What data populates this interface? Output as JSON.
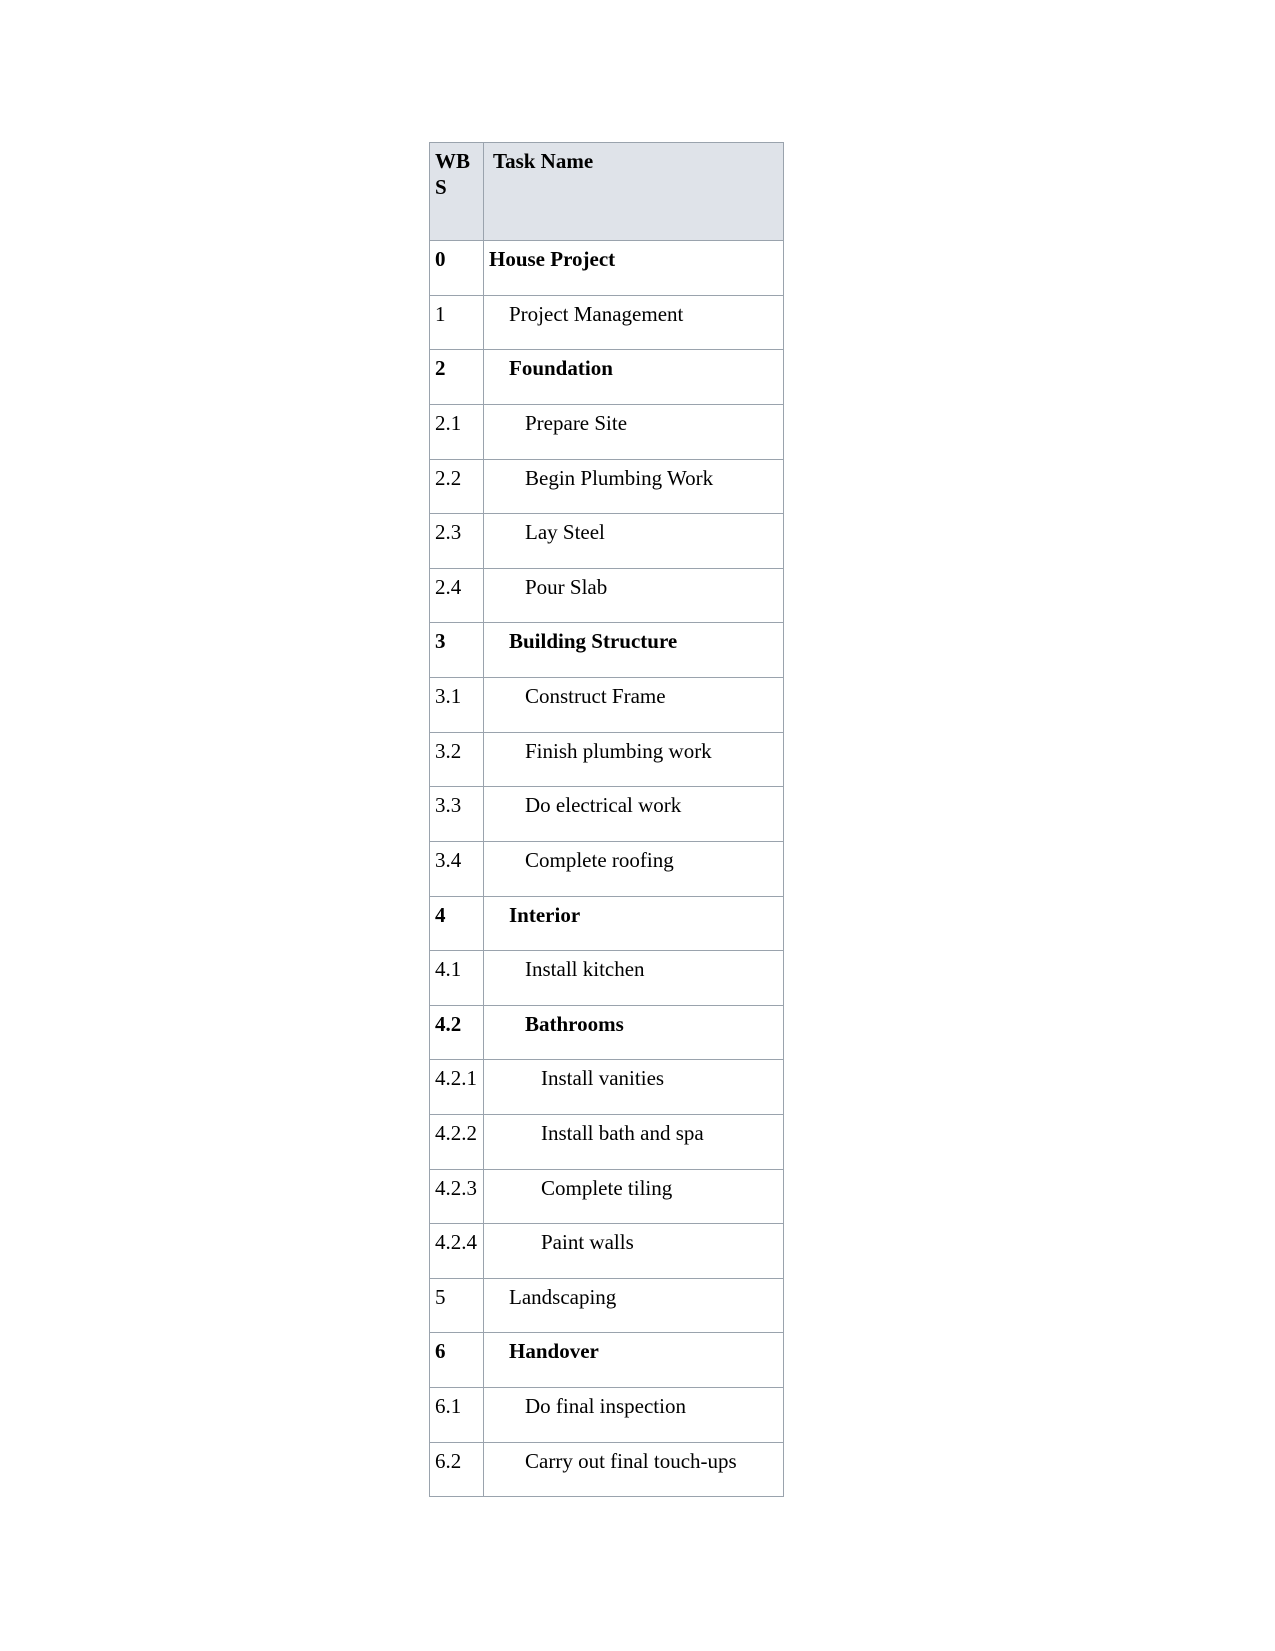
{
  "document": {
    "background_color": "#ffffff",
    "table": {
      "header_background": "#dfe3e9",
      "border_color": "#9aa3ad",
      "text_color": "#000000",
      "columns": [
        {
          "key": "wbs",
          "label": "WBS"
        },
        {
          "key": "task",
          "label": "Task Name"
        }
      ],
      "rows": [
        {
          "wbs": "0",
          "task": "House Project",
          "level": 0,
          "bold": true
        },
        {
          "wbs": "1",
          "task": "Project Management",
          "level": 1,
          "bold": false
        },
        {
          "wbs": "2",
          "task": "Foundation",
          "level": 1,
          "bold": true
        },
        {
          "wbs": "2.1",
          "task": "Prepare Site",
          "level": 2,
          "bold": false
        },
        {
          "wbs": "2.2",
          "task": "Begin Plumbing Work",
          "level": 2,
          "bold": false
        },
        {
          "wbs": "2.3",
          "task": "Lay Steel",
          "level": 2,
          "bold": false
        },
        {
          "wbs": "2.4",
          "task": "Pour Slab",
          "level": 2,
          "bold": false
        },
        {
          "wbs": "3",
          "task": "Building Structure",
          "level": 1,
          "bold": true
        },
        {
          "wbs": "3.1",
          "task": "Construct Frame",
          "level": 2,
          "bold": false
        },
        {
          "wbs": "3.2",
          "task": "Finish plumbing work",
          "level": 2,
          "bold": false
        },
        {
          "wbs": "3.3",
          "task": "Do electrical work",
          "level": 2,
          "bold": false
        },
        {
          "wbs": "3.4",
          "task": "Complete roofing",
          "level": 2,
          "bold": false
        },
        {
          "wbs": "4",
          "task": "Interior",
          "level": 1,
          "bold": true
        },
        {
          "wbs": "4.1",
          "task": "Install kitchen",
          "level": 2,
          "bold": false
        },
        {
          "wbs": "4.2",
          "task": "Bathrooms",
          "level": 2,
          "bold": true
        },
        {
          "wbs": "4.2.1",
          "task": "Install vanities",
          "level": 3,
          "bold": false
        },
        {
          "wbs": "4.2.2",
          "task": "Install bath and spa",
          "level": 3,
          "bold": false
        },
        {
          "wbs": "4.2.3",
          "task": "Complete tiling",
          "level": 3,
          "bold": false
        },
        {
          "wbs": "4.2.4",
          "task": "Paint walls",
          "level": 3,
          "bold": false
        },
        {
          "wbs": "5",
          "task": "Landscaping",
          "level": 1,
          "bold": false
        },
        {
          "wbs": "6",
          "task": "Handover",
          "level": 1,
          "bold": true
        },
        {
          "wbs": "6.1",
          "task": "Do final inspection",
          "level": 2,
          "bold": false
        },
        {
          "wbs": "6.2",
          "task": "Carry out final touch-ups",
          "level": 2,
          "bold": false
        }
      ]
    }
  }
}
